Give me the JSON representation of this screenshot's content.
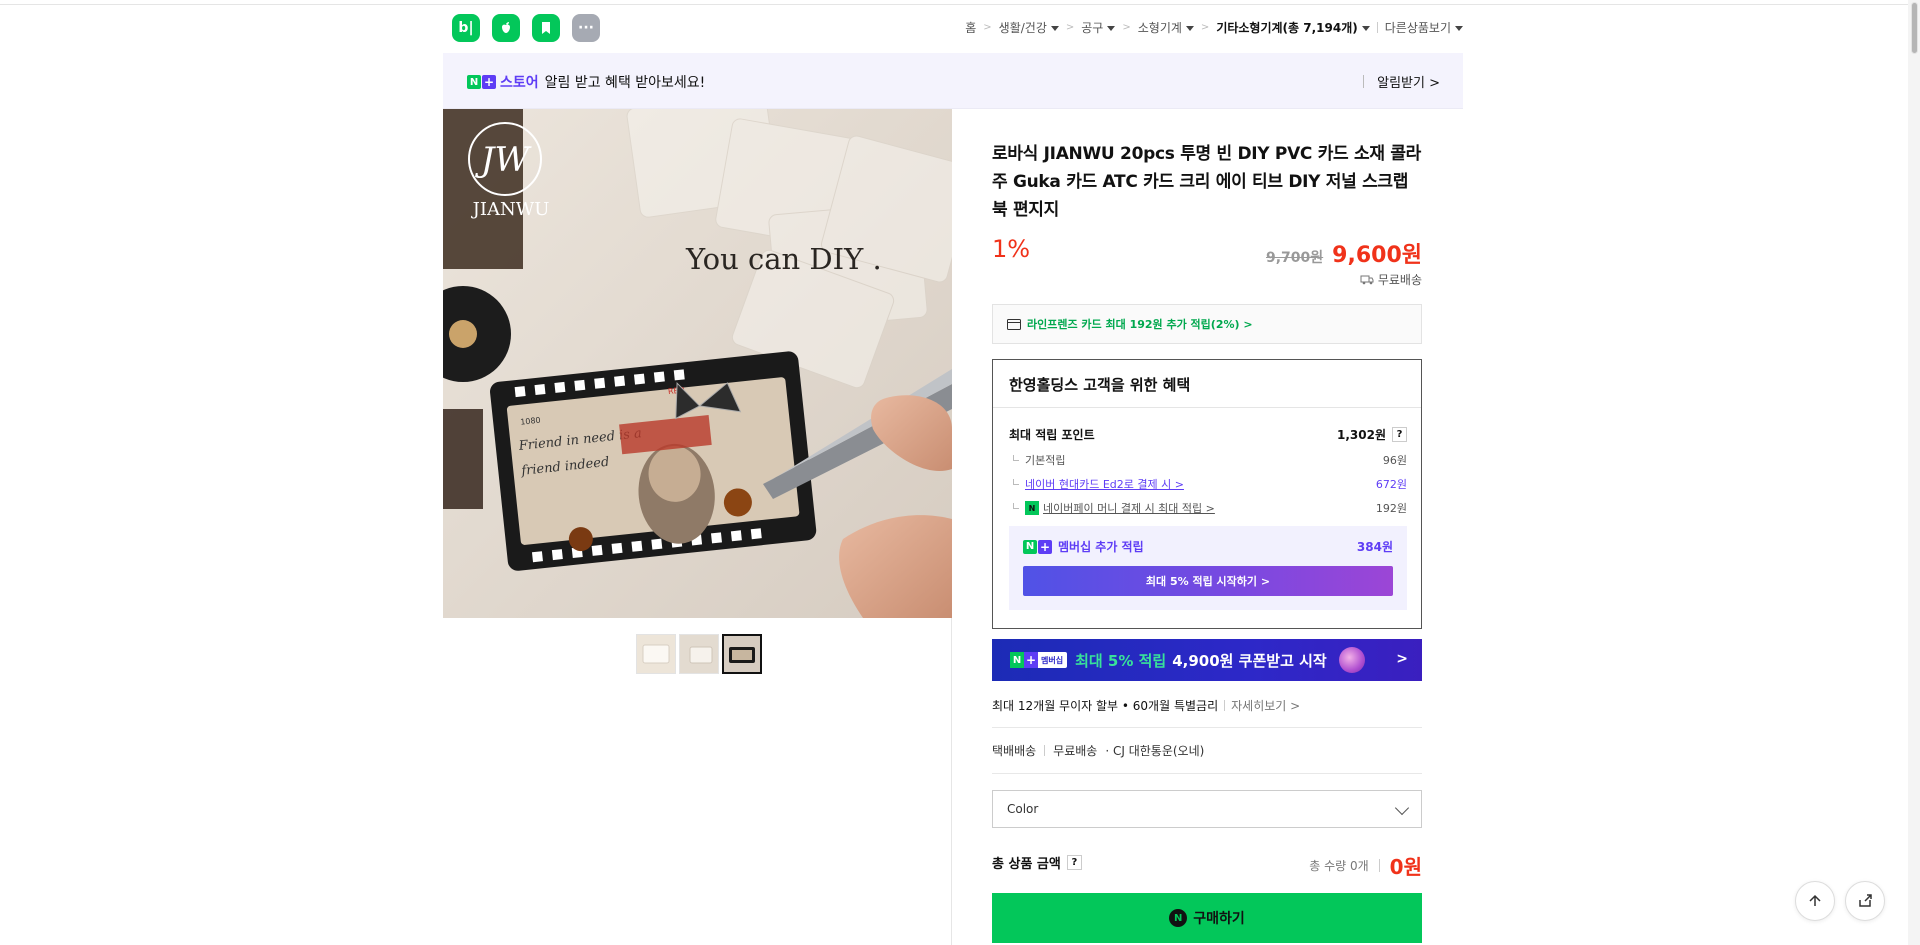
{
  "header": {
    "app_icons": [
      {
        "name": "blog-icon",
        "label": "b|"
      },
      {
        "name": "apple-app-icon",
        "label": ""
      },
      {
        "name": "bookmark-app-icon",
        "label": ""
      },
      {
        "name": "more-icon",
        "label": "···"
      }
    ],
    "breadcrumb": {
      "home": "홈",
      "c1": "생활/건강",
      "c2": "공구",
      "c3": "소형기계",
      "c4": "기타소형기계(총 7,194개)",
      "other": "다른상품보기"
    }
  },
  "store_banner": {
    "store_word": "스토어",
    "message": "알림 받고 혜택 받아보세요!",
    "alert": "알림받기 >"
  },
  "gallery": {
    "main_text": "You can DIY .",
    "logo_line1": "JW",
    "logo_line2": "JIANWU",
    "card_small": "1080",
    "card_red": "RED",
    "card_script1": "Friend in need is a",
    "card_script2": "friend indeed"
  },
  "product": {
    "title": "로바식 JIANWU 20pcs 투명 빈 DIY PVC 카드 소재 콜라주 Guka 카드 ATC 카드 크리 에이 티브 DIY 저널 스크랩북 편지지",
    "discount": "1%",
    "old_price": "9,700원",
    "new_price": "9,600원",
    "shipping": "무료배송",
    "card_offer": "라인프렌즈 카드 최대 192원 추가 적립(2%) >"
  },
  "benefit": {
    "heading": "한영홀딩스 고객을 위한 혜택",
    "max_label": "최대 적립 포인트",
    "max_value": "1,302원",
    "rows": [
      {
        "label": "기본적립",
        "value": "96원"
      },
      {
        "label": "네이버 현대카드 Ed2로 결제 시 >",
        "value": "672원"
      },
      {
        "label": "네이버페이 머니 결제 시 최대 적립 >",
        "value": "192원"
      }
    ],
    "member_label": "멤버십 추가 적립",
    "member_value": "384원",
    "member_button": "최대 5% 적립 시작하기 >"
  },
  "promo": {
    "tag": "멤버십",
    "highlight": "최대 5% 적립",
    "rest": "4,900원 쿠폰받고 시작"
  },
  "installment": {
    "text": "최대 12개월 무이자 할부 • 60개월 특별금리",
    "more": "자세히보기 >"
  },
  "delivery": {
    "type": "택배배송",
    "fee": "무료배송",
    "carrier": "· CJ 대한통운(오네)"
  },
  "option": {
    "placeholder": "Color"
  },
  "total": {
    "label": "총 상품 금액",
    "qty": "총 수량 0개",
    "amount": "0원"
  },
  "buy": {
    "label": "구매하기"
  },
  "colors": {
    "naver_green": "#03c75a",
    "purple": "#5e3df5",
    "red_price": "#f0321a"
  }
}
